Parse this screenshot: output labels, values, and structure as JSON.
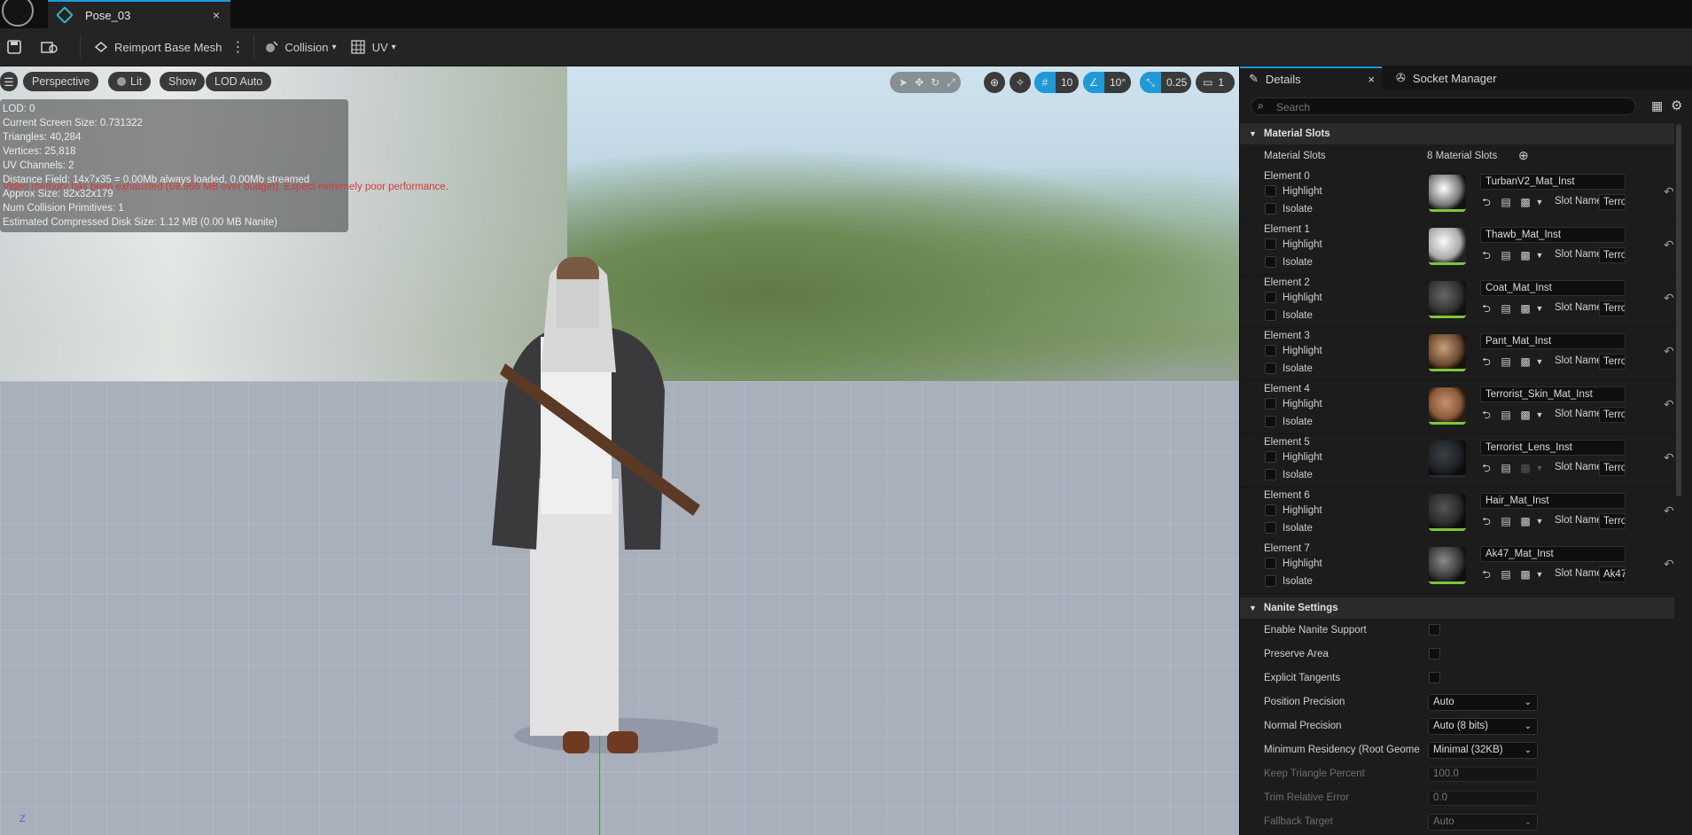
{
  "title_tab": {
    "name": "Pose_03",
    "close": "×",
    "icon": "static-mesh-icon"
  },
  "toolbar": {
    "reimport_label": "Reimport Base Mesh",
    "collision_label": "Collision",
    "uv_label": "UV"
  },
  "viewport": {
    "perspective_label": "Perspective",
    "lit_label": "Lit",
    "show_label": "Show",
    "lod_label": "LOD Auto",
    "grid_value": "10",
    "angle_value": "10°",
    "scale_value": "0.25",
    "camera_value": "1",
    "axis_label": "Z",
    "stats": [
      "LOD:  0",
      "Current Screen Size:  0.731322",
      "Triangles:  40,284",
      "Vertices:  25,818",
      "UV Channels:  2",
      "Distance Field:  14x7x35 = 0.00Mb always loaded, 0.00Mb streamed",
      "Approx Size: 82x32x179",
      "Num Collision Primitives:  1",
      "Estimated Compressed Disk Size: 1.12 MB (0.00 MB Nanite)"
    ],
    "warning": "Video memory has been exhausted (69.966 MB over budget). Expect extremely poor performance."
  },
  "details": {
    "tab_details": "Details",
    "tab_close": "×",
    "tab_socket": "Socket Manager",
    "search_placeholder": "Search",
    "material_section": "Material Slots",
    "material_slots_label": "Material Slots",
    "material_slots_count": "8 Material Slots",
    "highlight_label": "Highlight",
    "isolate_label": "Isolate",
    "slot_name_label": "Slot Name",
    "elements": [
      {
        "label": "Element 0",
        "material": "TurbanV2_Mat_Inst",
        "slot": "Terro"
      },
      {
        "label": "Element 1",
        "material": "Thawb_Mat_Inst",
        "slot": "Terro"
      },
      {
        "label": "Element 2",
        "material": "Coat_Mat_Inst",
        "slot": "Terro"
      },
      {
        "label": "Element 3",
        "material": "Pant_Mat_Inst",
        "slot": "Terro"
      },
      {
        "label": "Element 4",
        "material": "Terrorist_Skin_Mat_Inst",
        "slot": "Terro"
      },
      {
        "label": "Element 5",
        "material": "Terrorist_Lens_Inst",
        "slot": "Terro"
      },
      {
        "label": "Element 6",
        "material": "Hair_Mat_Inst",
        "slot": "Terro"
      },
      {
        "label": "Element 7",
        "material": "Ak47_Mat_Inst",
        "slot": "Ak47_"
      }
    ],
    "nanite_section": "Nanite Settings",
    "nanite": {
      "enable_label": "Enable Nanite Support",
      "preserve_label": "Preserve Area",
      "explicit_label": "Explicit Tangents",
      "position_label": "Position Precision",
      "position_value": "Auto",
      "normal_label": "Normal Precision",
      "normal_value": "Auto (8 bits)",
      "residency_label": "Minimum Residency (Root Geome",
      "residency_value": "Minimal (32KB)",
      "keep_label": "Keep Triangle Percent",
      "keep_value": "100.0",
      "trim_label": "Trim Relative Error",
      "trim_value": "0.0",
      "fallback_label": "Fallback Target",
      "fallback_value": "Auto"
    }
  },
  "colors": {
    "accent": "#1f9ad6",
    "highlight_green": "#7ec63c",
    "warning_red": "#d23a3a"
  }
}
